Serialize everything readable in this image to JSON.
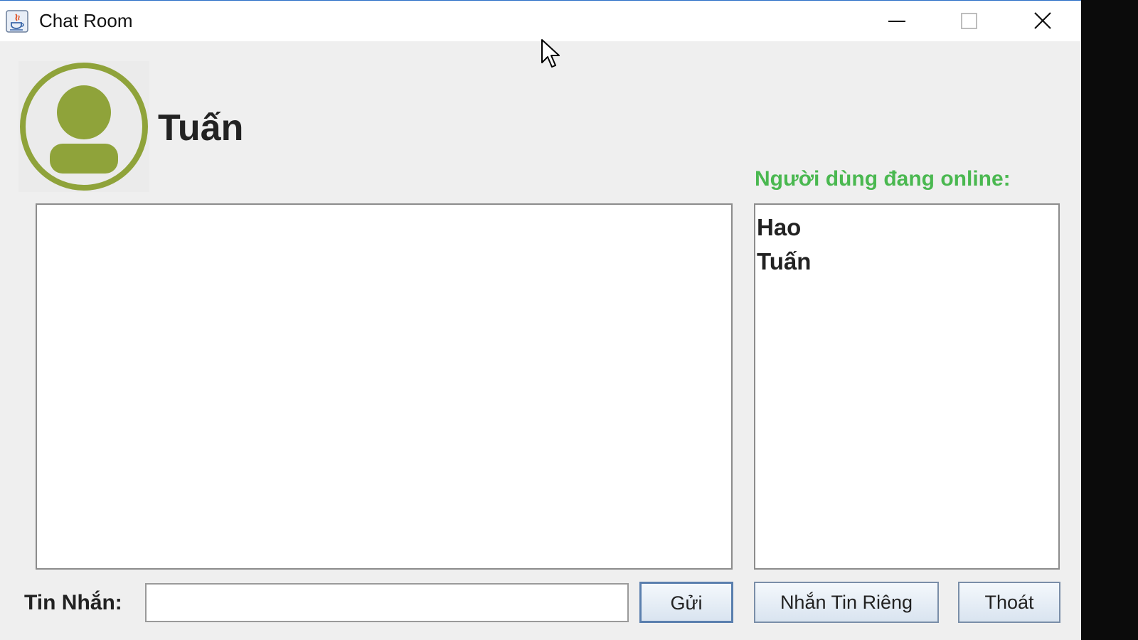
{
  "window": {
    "title": "Chat Room",
    "controls": [
      "minimize-icon",
      "maximize-icon",
      "close-icon"
    ]
  },
  "profile": {
    "username": "Tuấn",
    "avatar_icon": "user-avatar-icon",
    "avatar_color": "#8fa33a"
  },
  "online_users": {
    "label": "Người dùng đang online:",
    "label_color": "#4ab850",
    "users": [
      "Hao",
      "Tuấn"
    ]
  },
  "chat": {
    "messages": []
  },
  "message_bar": {
    "label": "Tin Nhắn:",
    "input_value": "",
    "send_label": "Gửi",
    "private_label": "Nhắn Tin Riêng",
    "exit_label": "Thoát"
  }
}
